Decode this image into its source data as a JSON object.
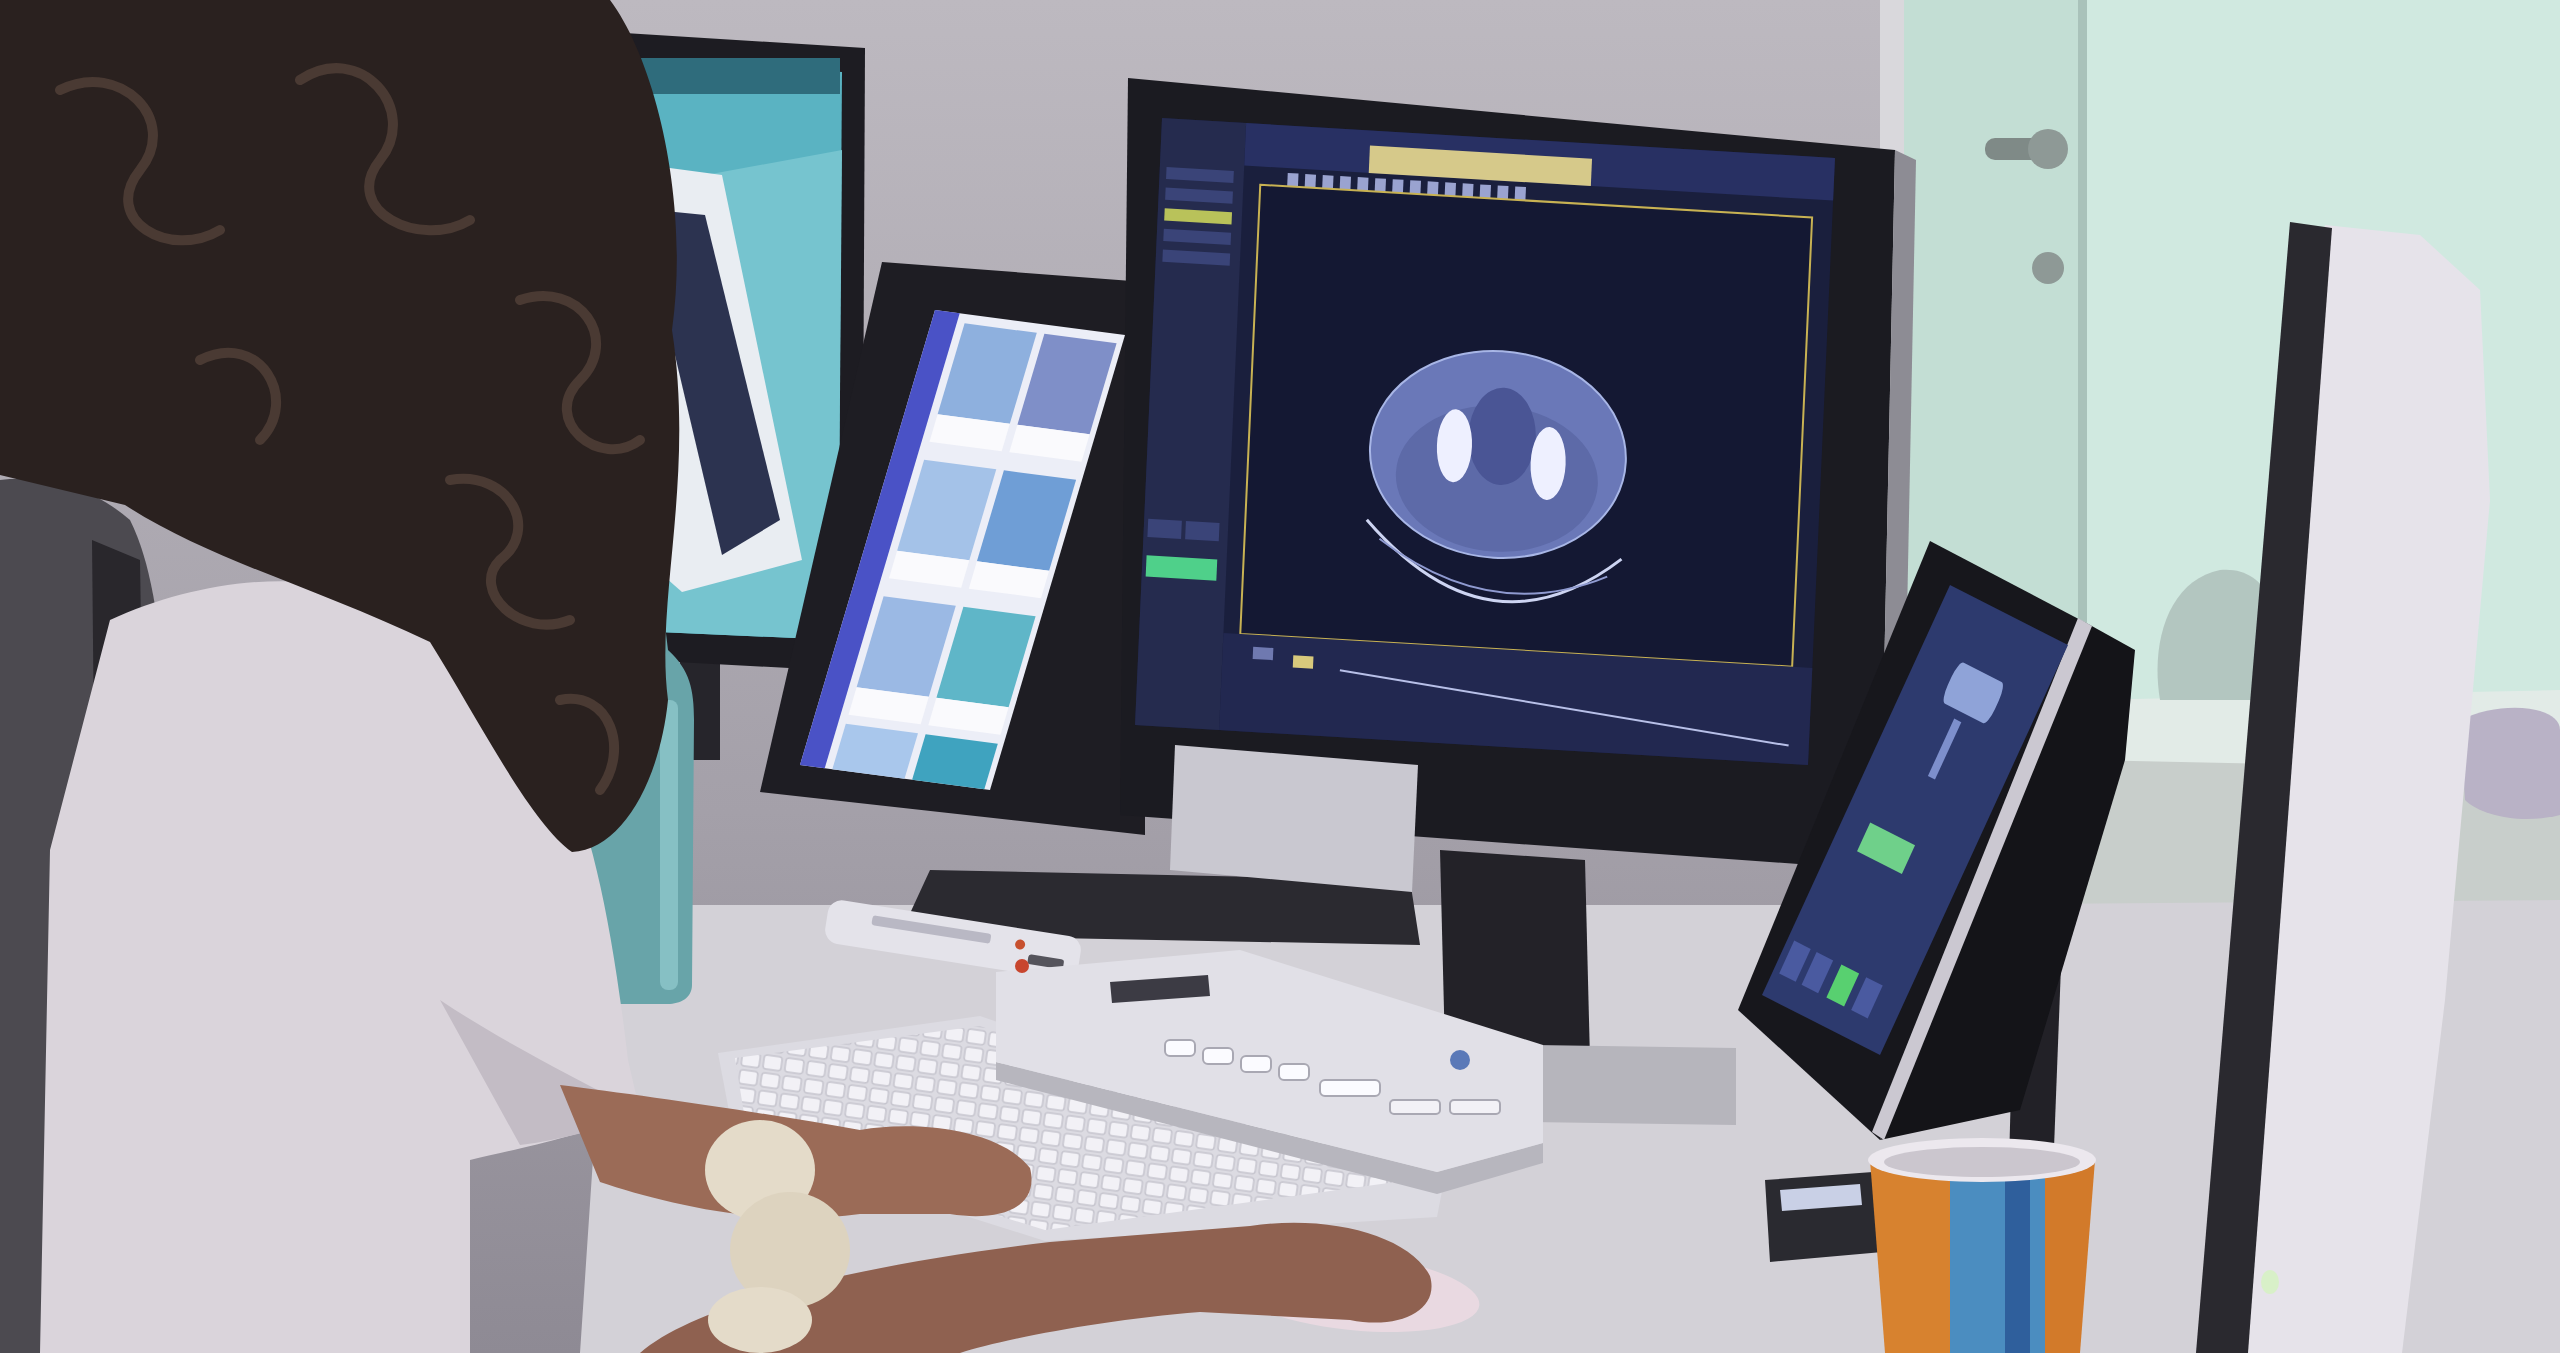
{
  "photo": {
    "objects": [
      {
        "kind": "wall"
      },
      {
        "kind": "glass-door"
      },
      {
        "kind": "desk"
      },
      {
        "kind": "camera-monitor"
      },
      {
        "kind": "gallery-monitor"
      },
      {
        "kind": "ct-monitor"
      },
      {
        "kind": "control-tablet"
      },
      {
        "kind": "side-monitor"
      },
      {
        "kind": "water-bottle"
      },
      {
        "kind": "remote"
      },
      {
        "kind": "keyboard"
      },
      {
        "kind": "control-console"
      },
      {
        "kind": "mouse"
      },
      {
        "kind": "cup"
      },
      {
        "kind": "chair"
      },
      {
        "kind": "person"
      }
    ]
  }
}
